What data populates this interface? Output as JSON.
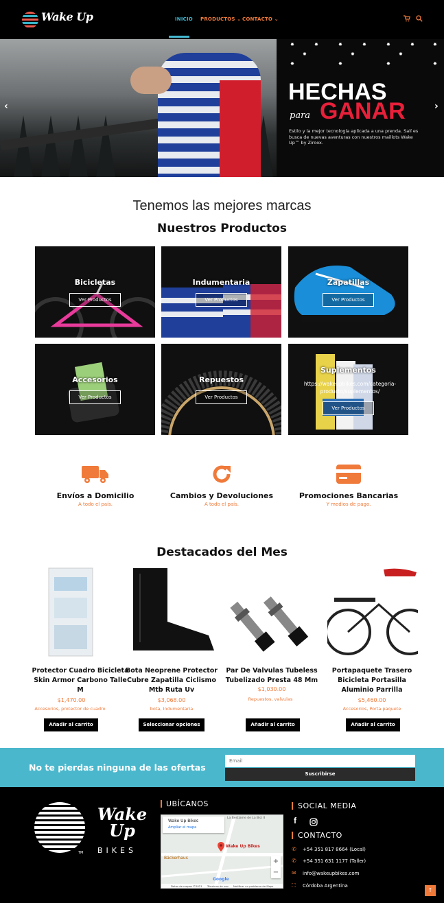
{
  "header": {
    "logo_text": "Wake Up",
    "nav": [
      {
        "label": "INICIO"
      },
      {
        "label": "PRODUCTOS ⌄"
      },
      {
        "label": "CONTACTO ⌄"
      }
    ],
    "icons": [
      "cart-icon",
      "search-icon"
    ]
  },
  "hero": {
    "title_line1": "HECHAS",
    "title_para": "para",
    "title_line2": "GANAR",
    "description": "Estilo y la mejor tecnología aplicada a una prenda. Salí es busca de nuevas aventuras con nuestros maillots Wake Up™ by Ziroox.",
    "prev_arrow": "‹",
    "next_arrow": "›"
  },
  "brands_heading": "Tenemos las mejores marcas",
  "products_heading": "Nuestros Productos",
  "categories": [
    {
      "title": "Bicicletas",
      "button": "Ver Productos"
    },
    {
      "title": "Indumentaria",
      "button": "Ver Productos"
    },
    {
      "title": "Zapatillas",
      "button": "Ver Productos"
    },
    {
      "title": "Accesorios",
      "button": "Ver Productos"
    },
    {
      "title": "Repuestos",
      "button": "Ver Productos"
    },
    {
      "title": "Suplementos",
      "button": "Ver Productos",
      "url_overlay": "https://wakeupbikes.com/categoria-producto/suplementos/"
    }
  ],
  "features": [
    {
      "title": "Envíos a Domicilio",
      "subtitle": "A todo el país.",
      "icon": "truck-icon"
    },
    {
      "title": "Cambios y Devoluciones",
      "subtitle": "A todo el país.",
      "icon": "refresh-icon"
    },
    {
      "title": "Promociones Bancarias",
      "subtitle": "Y medios de pago.",
      "icon": "credit-card-icon"
    }
  ],
  "featured_heading": "Destacados del Mes",
  "products": [
    {
      "name": "Protector Cuadro Bicicleta Skin Armor Carbono Talle M",
      "price": "$1,470.00",
      "categories": "Accesorios, protector de cuadro",
      "button": "Añadir al carrito"
    },
    {
      "name": "Bota Neoprene Protector Cubre Zapatilla Ciclismo Mtb Ruta Uv",
      "price": "$3,068.00",
      "categories": "bota, Indumentaria",
      "button": "Seleccionar opciones"
    },
    {
      "name": "Par De Valvulas Tubeless Tubelizado Presta 48 Mm",
      "price": "$1,030.00",
      "categories": "Repuestos, valvulas",
      "button": "Añadir al carrito"
    },
    {
      "name": "Portapaquete Trasero Bicicleta Portasilla Aluminio Parrilla",
      "price": "$5,460.00",
      "categories": "Accesorios, Porta paquete",
      "button": "Añadir al carrito"
    }
  ],
  "newsletter": {
    "text": "No te pierdas ninguna de las ofertas",
    "email_placeholder": "Email",
    "button": "Suscribirse"
  },
  "footer": {
    "brand": "Wake Up",
    "brand_sub": "BIKES",
    "tm": "TM",
    "location_heading": "UBÍCANOS",
    "map": {
      "place": "Wake Up Bikes",
      "link": "Ampliar el mapa",
      "pin_label": "Wake Up Bikes",
      "poi": "Bäckerhaus",
      "street_top": "La Bestiame de La Bici II",
      "attribution": "Datos de mapas ©2021",
      "terms": "Términos de uso",
      "report": "Notificar un problema de Maps",
      "google": "Google",
      "zoom_in": "+",
      "zoom_out": "−"
    },
    "social_heading": "SOCIAL MEDIA",
    "contact_heading": "CONTACTO",
    "contacts": [
      {
        "icon": "whatsapp-icon",
        "text": "+54 351 817 8664 (Local)"
      },
      {
        "icon": "whatsapp-icon",
        "text": "+54 351 631 1177 (Taller)"
      },
      {
        "icon": "mail-icon",
        "text": "info@wakeupbikes.com"
      },
      {
        "icon": "map-icon",
        "text": "Córdoba Argentina"
      }
    ],
    "to_top": "↑"
  },
  "colors": {
    "accent": "#f07a3a",
    "teal": "#4ab7cc",
    "hero_red": "#e8203a"
  }
}
